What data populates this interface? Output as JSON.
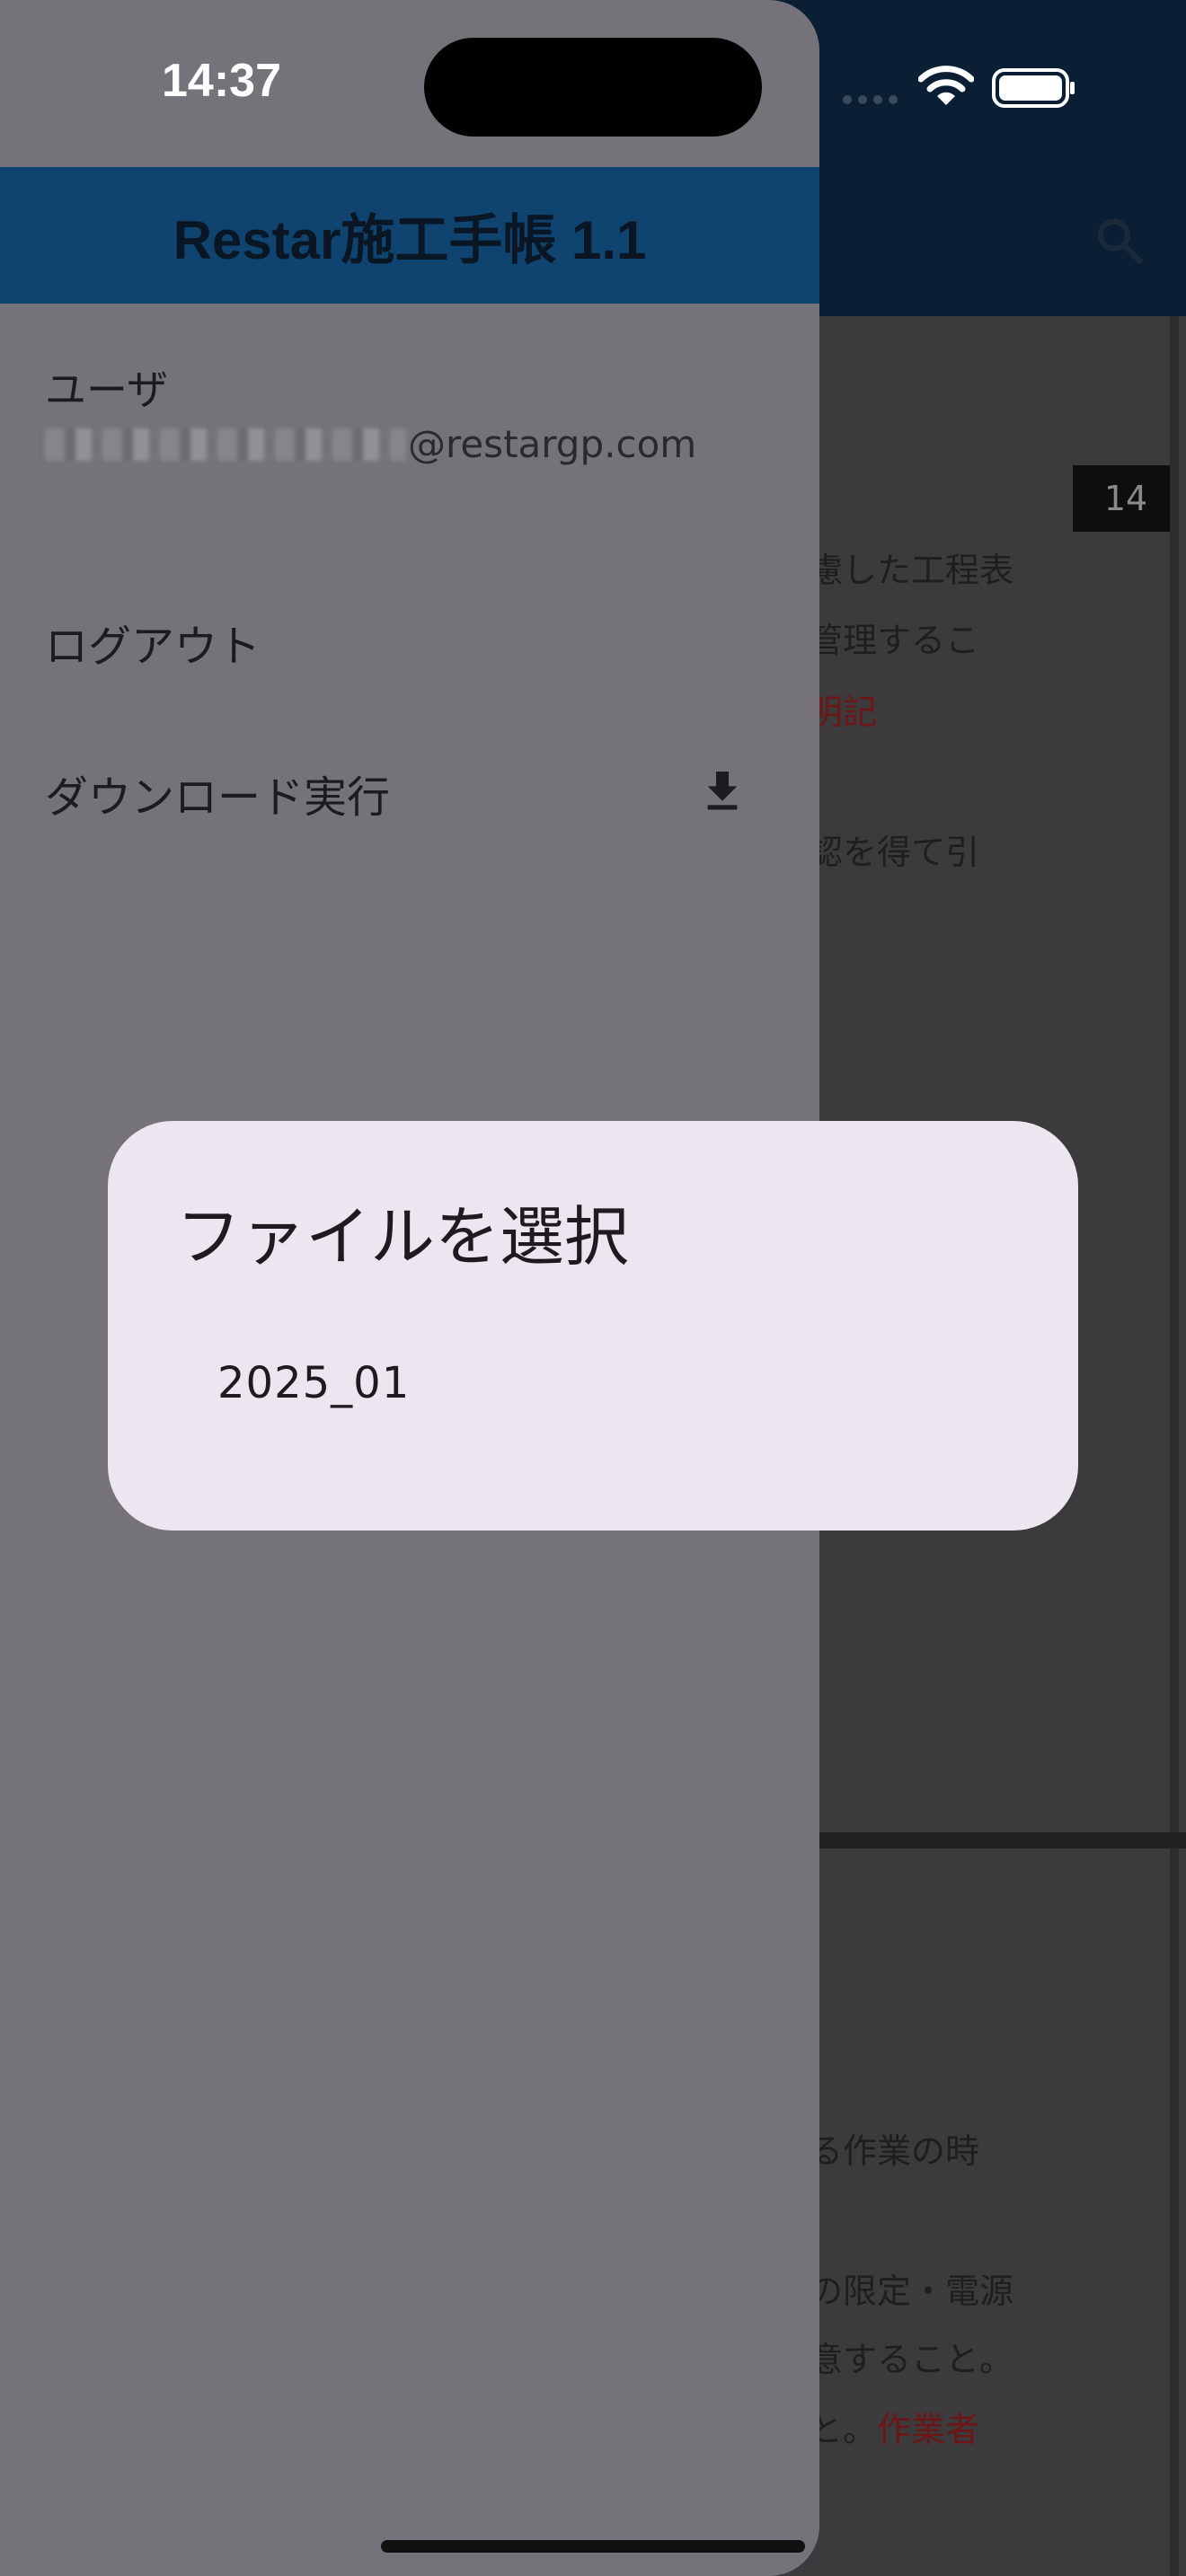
{
  "status_bar": {
    "time": "14:37"
  },
  "drawer": {
    "title": "Restar施工手帳 1.1",
    "user_label": "ユーザ",
    "user_email_domain": "@restargp.com",
    "menu": {
      "logout": "ログアウト",
      "download": "ダウンロード実行"
    }
  },
  "background": {
    "badge": "14",
    "lines": [
      {
        "text": "慮した工程表",
        "red": ""
      },
      {
        "text": "管理するこ",
        "red": ""
      },
      {
        "text": "",
        "red": "明記"
      },
      {
        "text": "認を得て引",
        "red": ""
      },
      {
        "text": "る作業の時",
        "red": ""
      },
      {
        "text": "の限定・電源",
        "red": ""
      },
      {
        "text": "意すること。",
        "red": ""
      },
      {
        "text": "と。",
        "red": "作業者"
      }
    ]
  },
  "dialog": {
    "title": "ファイルを選択",
    "options": [
      "2025_01"
    ]
  },
  "colors": {
    "drawer_header": "#104470",
    "dialog_bg": "#ece6f0",
    "accent_red": "#6e1616"
  }
}
